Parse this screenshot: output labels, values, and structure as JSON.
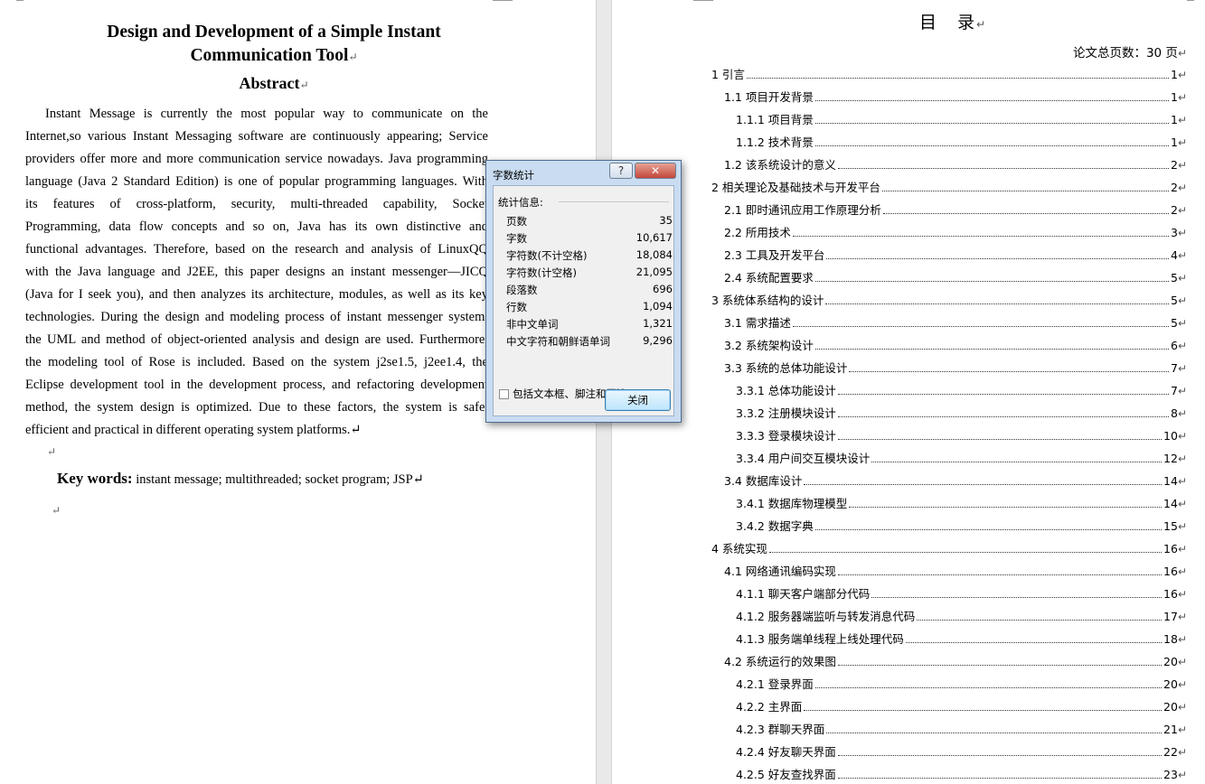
{
  "left_page": {
    "title_lines": [
      "Design and Development of a Simple Instant",
      "Communication Tool"
    ],
    "para_mark": "↵",
    "abstract_heading": "Abstract",
    "abstract_lines": [
      "Instant Message is currently the most popular way to communicate on the",
      "Internet,so various Instant Messaging software are continuously appearing; Service",
      "providers offer more and more communication service nowadays. Java programming",
      "language (Java 2 Standard Edition) is one of popular programming languages. With",
      "its features of cross-platform, security, multi-threaded capability, Socket",
      "Programming, data flow concepts and so on, Java has its own distinctive and",
      "functional advantages. Therefore, based on the research and analysis of LinuxQQ",
      "with the Java language and J2EE, this paper designs an instant messenger—JICQ",
      "(Java for I seek you), and then analyzes its architecture, modules, as well as its key",
      "technologies. During the design and modeling process of instant messenger system,",
      "the UML and method of object-oriented analysis and design are used. Furthermore,",
      "the modeling tool of Rose is included. Based on the system j2se1.5, j2ee1.4, the",
      "Eclipse development tool in the development process, and refactoring development",
      "method, the system design is optimized. Due to these factors, the system is safe,",
      "efficient and practical in different operating system platforms.↵"
    ],
    "keywords_label": "Key words:",
    "keywords_text": " instant message; multithreaded; socket program; JSP↵"
  },
  "right_page": {
    "toc_title": "目　录",
    "total_pages": "论文总页数：30 页",
    "toc": [
      {
        "text": "1  引言",
        "page": "1"
      },
      {
        "text": "1.1  项目开发背景",
        "page": "1"
      },
      {
        "text": "1.1.1  项目背景",
        "page": "1"
      },
      {
        "text": "1.1.2  技术背景",
        "page": "1"
      },
      {
        "text": "1.2 该系统设计的意义",
        "page": "2"
      },
      {
        "text": "2 相关理论及基础技术与开发平台",
        "page": "2"
      },
      {
        "text": "2.1  即时通讯应用工作原理分析",
        "page": "2"
      },
      {
        "text": "2.2 所用技术",
        "page": "3"
      },
      {
        "text": "2.3 工具及开发平台",
        "page": "4"
      },
      {
        "text": "2.4  系统配置要求",
        "page": "5"
      },
      {
        "text": "3 系统体系结构的设计",
        "page": "5"
      },
      {
        "text": "3.1  需求描述",
        "page": "5"
      },
      {
        "text": "3.2 系统架构设计",
        "page": "6"
      },
      {
        "text": "3.3  系统的总体功能设计",
        "page": "7"
      },
      {
        "text": "3.3.1 总体功能设计",
        "page": "7"
      },
      {
        "text": "3.3.2 注册模块设计",
        "page": "8"
      },
      {
        "text": "3.3.3  登录模块设计",
        "page": "10"
      },
      {
        "text": "3.3.4 用户间交互模块设计",
        "page": "12"
      },
      {
        "text": "3.4 数据库设计",
        "page": "14"
      },
      {
        "text": "3.4.1 数据库物理模型",
        "page": "14"
      },
      {
        "text": "3.4.2 数据字典",
        "page": "15"
      },
      {
        "text": "4 系统实现",
        "page": "16"
      },
      {
        "text": "4.1 网络通讯编码实现",
        "page": "16"
      },
      {
        "text": "4.1.1 聊天客户端部分代码",
        "page": "16"
      },
      {
        "text": "4.1.2 服务器端监听与转发消息代码",
        "page": "17"
      },
      {
        "text": "4.1.3 服务端单线程上线处理代码",
        "page": "18"
      },
      {
        "text": "4.2  系统运行的效果图",
        "page": "20"
      },
      {
        "text": "4.2.1  登录界面",
        "page": "20"
      },
      {
        "text": "4.2.2  主界面",
        "page": "20"
      },
      {
        "text": "4.2.3  群聊天界面",
        "page": "21"
      },
      {
        "text": "4.2.4  好友聊天界面",
        "page": "22"
      },
      {
        "text": "4.2.5  好友查找界面",
        "page": "23"
      }
    ]
  },
  "dialog": {
    "title": "字数统计",
    "help_label": "?",
    "close_x_label": "✕",
    "stats_heading": "统计信息:",
    "stats": [
      {
        "label": "页数",
        "value": "35"
      },
      {
        "label": "字数",
        "value": "10,617"
      },
      {
        "label": "字符数(不计空格)",
        "value": "18,084"
      },
      {
        "label": "字符数(计空格)",
        "value": "21,095"
      },
      {
        "label": "段落数",
        "value": "696"
      },
      {
        "label": "行数",
        "value": "1,094"
      },
      {
        "label": "非中文单词",
        "value": "1,321"
      },
      {
        "label": "中文字符和朝鲜语单词",
        "value": "9,296"
      }
    ],
    "checkbox_label": "包括文本框、脚注和尾注(F)",
    "checkbox_checked": false,
    "close_button": "关闭"
  }
}
